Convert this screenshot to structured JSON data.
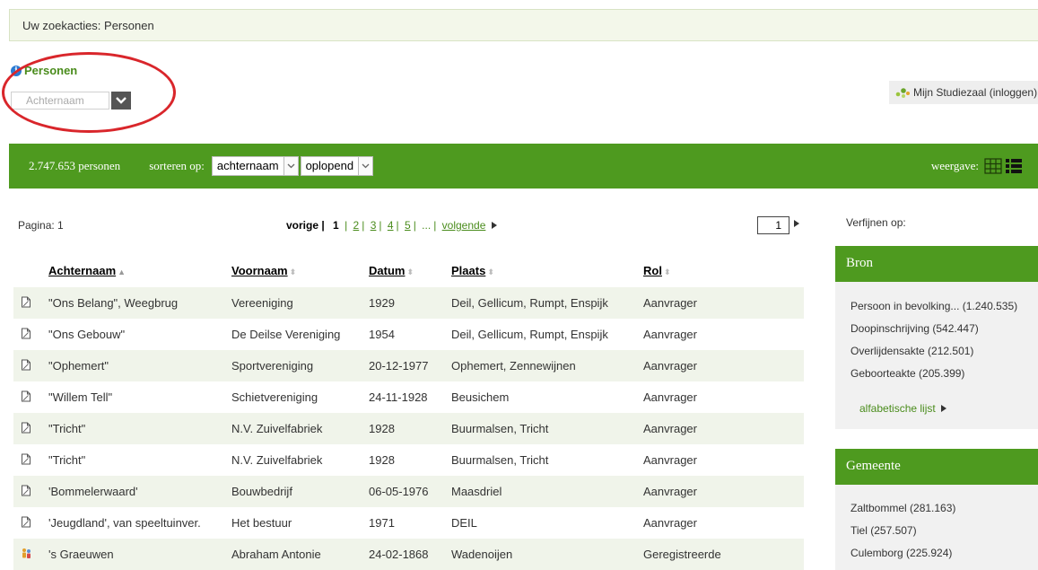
{
  "topbar": {
    "text": "Uw zoekacties: Personen"
  },
  "search": {
    "title": "Personen",
    "placeholder": "Achternaam"
  },
  "account": {
    "link": "Mijn Studiezaal (inloggen)"
  },
  "toolbar": {
    "count": "2.747.653 personen",
    "sort_label": "sorteren op:",
    "sort_field": "achternaam",
    "sort_order": "oplopend",
    "view_label": "weergave:"
  },
  "pager": {
    "page_label": "Pagina: 1",
    "prev": "vorige |",
    "current": "1",
    "pages": [
      "2",
      "3",
      "4",
      "5"
    ],
    "ellipsis": "...",
    "next": "volgende",
    "input_value": "1"
  },
  "table": {
    "headers": {
      "achternaam": "Achternaam",
      "voornaam": "Voornaam",
      "datum": "Datum",
      "plaats": "Plaats",
      "rol": "Rol"
    },
    "rows": [
      {
        "icon": "document-icon",
        "achternaam": "\"Ons Belang\", Weegbrug",
        "voornaam": "Vereeniging",
        "datum": "1929",
        "plaats": "Deil, Gellicum, Rumpt, Enspijk",
        "rol": "Aanvrager"
      },
      {
        "icon": "document-icon",
        "achternaam": "\"Ons Gebouw\"",
        "voornaam": "De Deilse Vereniging",
        "datum": "1954",
        "plaats": "Deil, Gellicum, Rumpt, Enspijk",
        "rol": "Aanvrager"
      },
      {
        "icon": "document-icon",
        "achternaam": "\"Ophemert\"",
        "voornaam": "Sportvereniging",
        "datum": "20-12-1977",
        "plaats": "Ophemert, Zennewijnen",
        "rol": "Aanvrager"
      },
      {
        "icon": "document-icon",
        "achternaam": "\"Willem Tell\"",
        "voornaam": "Schietvereniging",
        "datum": "24-11-1928",
        "plaats": "Beusichem",
        "rol": "Aanvrager"
      },
      {
        "icon": "document-icon",
        "achternaam": "\"Tricht\"",
        "voornaam": "N.V. Zuivelfabriek",
        "datum": "1928",
        "plaats": "Buurmalsen, Tricht",
        "rol": "Aanvrager"
      },
      {
        "icon": "document-icon",
        "achternaam": "\"Tricht\"",
        "voornaam": "N.V. Zuivelfabriek",
        "datum": "1928",
        "plaats": "Buurmalsen, Tricht",
        "rol": "Aanvrager"
      },
      {
        "icon": "document-icon",
        "achternaam": "'Bommelerwaard'",
        "voornaam": "Bouwbedrijf",
        "datum": "06-05-1976",
        "plaats": "Maasdriel",
        "rol": "Aanvrager"
      },
      {
        "icon": "document-icon",
        "achternaam": "'Jeugdland', van speeltuinver.",
        "voornaam": "Het bestuur",
        "datum": "1971",
        "plaats": "DEIL",
        "rol": "Aanvrager"
      },
      {
        "icon": "people-icon",
        "achternaam": "'s Graeuwen",
        "voornaam": "Abraham Antonie",
        "datum": "24-02-1868",
        "plaats": "Wadenoijen",
        "rol": "Geregistreerde"
      }
    ]
  },
  "sidebar": {
    "title": "Verfijnen op:",
    "bron": {
      "title": "Bron",
      "items": [
        "Persoon in bevolking... (1.240.535)",
        "Doopinschrijving (542.447)",
        "Overlijdensakte (212.501)",
        "Geboorteakte (205.399)"
      ],
      "more": "alfabetische lijst"
    },
    "gemeente": {
      "title": "Gemeente",
      "items": [
        "Zaltbommel (281.163)",
        "Tiel (257.507)",
        "Culemborg (225.924)"
      ]
    }
  }
}
